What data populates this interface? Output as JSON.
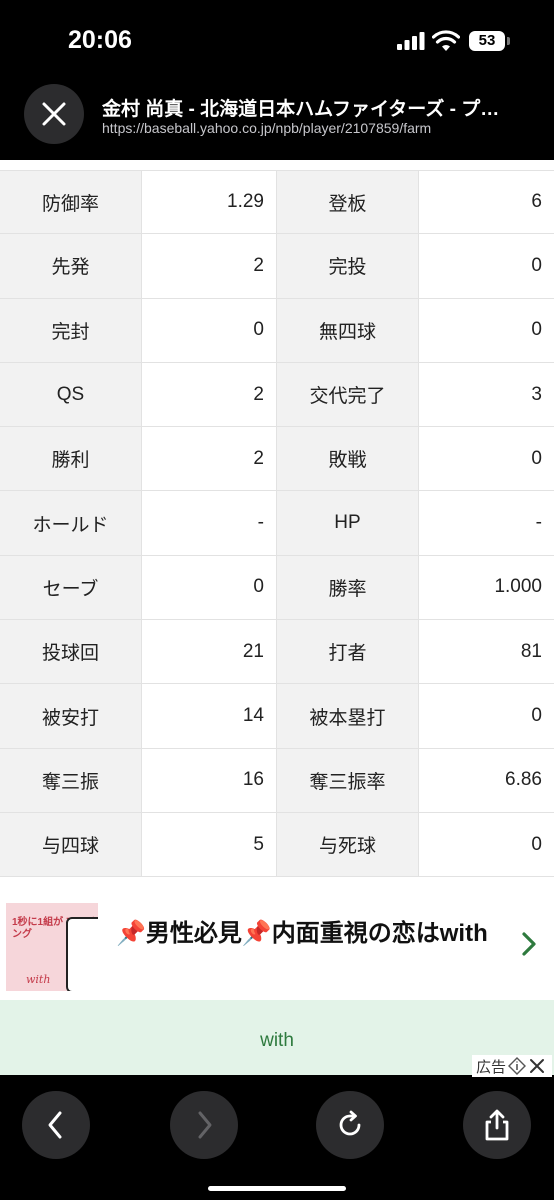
{
  "status_bar": {
    "time": "20:06",
    "battery": "53"
  },
  "browser": {
    "title": "金村 尚真 - 北海道日本ハムファイターズ - プ…",
    "url": "https://baseball.yahoo.co.jp/npb/player/2107859/farm"
  },
  "stats": [
    {
      "label1": "防御率",
      "value1": "1.29",
      "label2": "登板",
      "value2": "6"
    },
    {
      "label1": "先発",
      "value1": "2",
      "label2": "完投",
      "value2": "0"
    },
    {
      "label1": "完封",
      "value1": "0",
      "label2": "無四球",
      "value2": "0"
    },
    {
      "label1": "QS",
      "value1": "2",
      "label2": "交代完了",
      "value2": "3"
    },
    {
      "label1": "勝利",
      "value1": "2",
      "label2": "敗戦",
      "value2": "0"
    },
    {
      "label1": "ホールド",
      "value1": "-",
      "label2": "HP",
      "value2": "-"
    },
    {
      "label1": "セーブ",
      "value1": "0",
      "label2": "勝率",
      "value2": "1.000"
    },
    {
      "label1": "投球回",
      "value1": "21",
      "label2": "打者",
      "value2": "81"
    },
    {
      "label1": "被安打",
      "value1": "14",
      "label2": "被本塁打",
      "value2": "0"
    },
    {
      "label1": "奪三振",
      "value1": "16",
      "label2": "奪三振率",
      "value2": "6.86"
    },
    {
      "label1": "与四球",
      "value1": "5",
      "label2": "与死球",
      "value2": "0"
    }
  ],
  "ad": {
    "thumb_text": "1秒に1組が マッチング",
    "thumb_logo": "with",
    "headline": "📌男性必見📌内面重視の恋はwith",
    "brand": "with",
    "choice_label": "広告"
  },
  "icons": {
    "close": "close-icon",
    "back": "chevron-left-icon",
    "forward": "chevron-right-icon",
    "reload": "reload-icon",
    "share": "share-icon"
  }
}
